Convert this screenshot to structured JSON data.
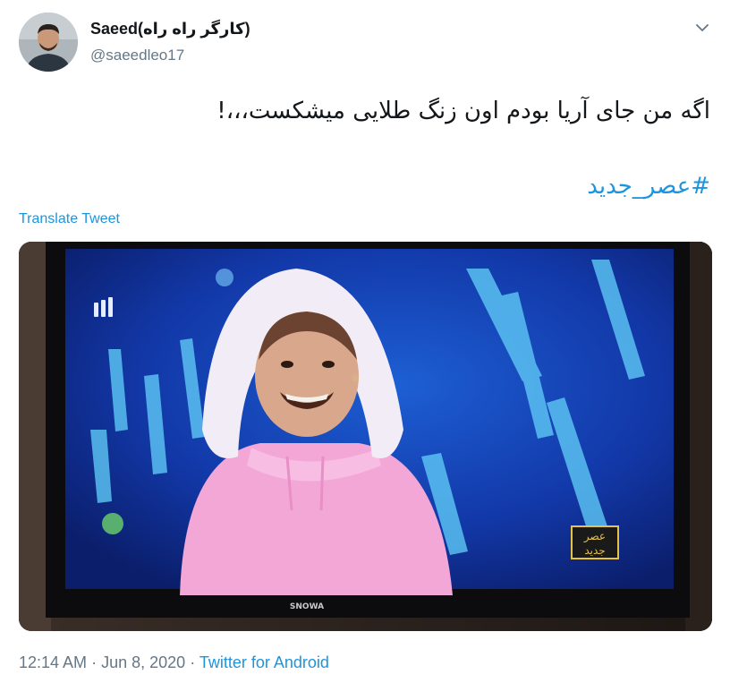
{
  "author": {
    "name": "Saeed(کارگر راه راه)",
    "handle": "@saeedleo17"
  },
  "tweet": {
    "text": "اگه من جای آریا بودم اون زنگ طلایی  میشکست،،،!",
    "hashtag": "#عصر_جدید",
    "translate_label": "Translate Tweet"
  },
  "media": {
    "tv_brand": "SNOWA",
    "show_logo_line1": "عصر",
    "show_logo_line2": "جدید",
    "channel_logo": "3"
  },
  "footer": {
    "time": "12:14 AM",
    "date": "Jun 8, 2020",
    "separator": "·",
    "source": "Twitter for Android"
  },
  "colors": {
    "link": "#1b95e0",
    "secondary_text": "#657786",
    "primary_text": "#14171a"
  }
}
